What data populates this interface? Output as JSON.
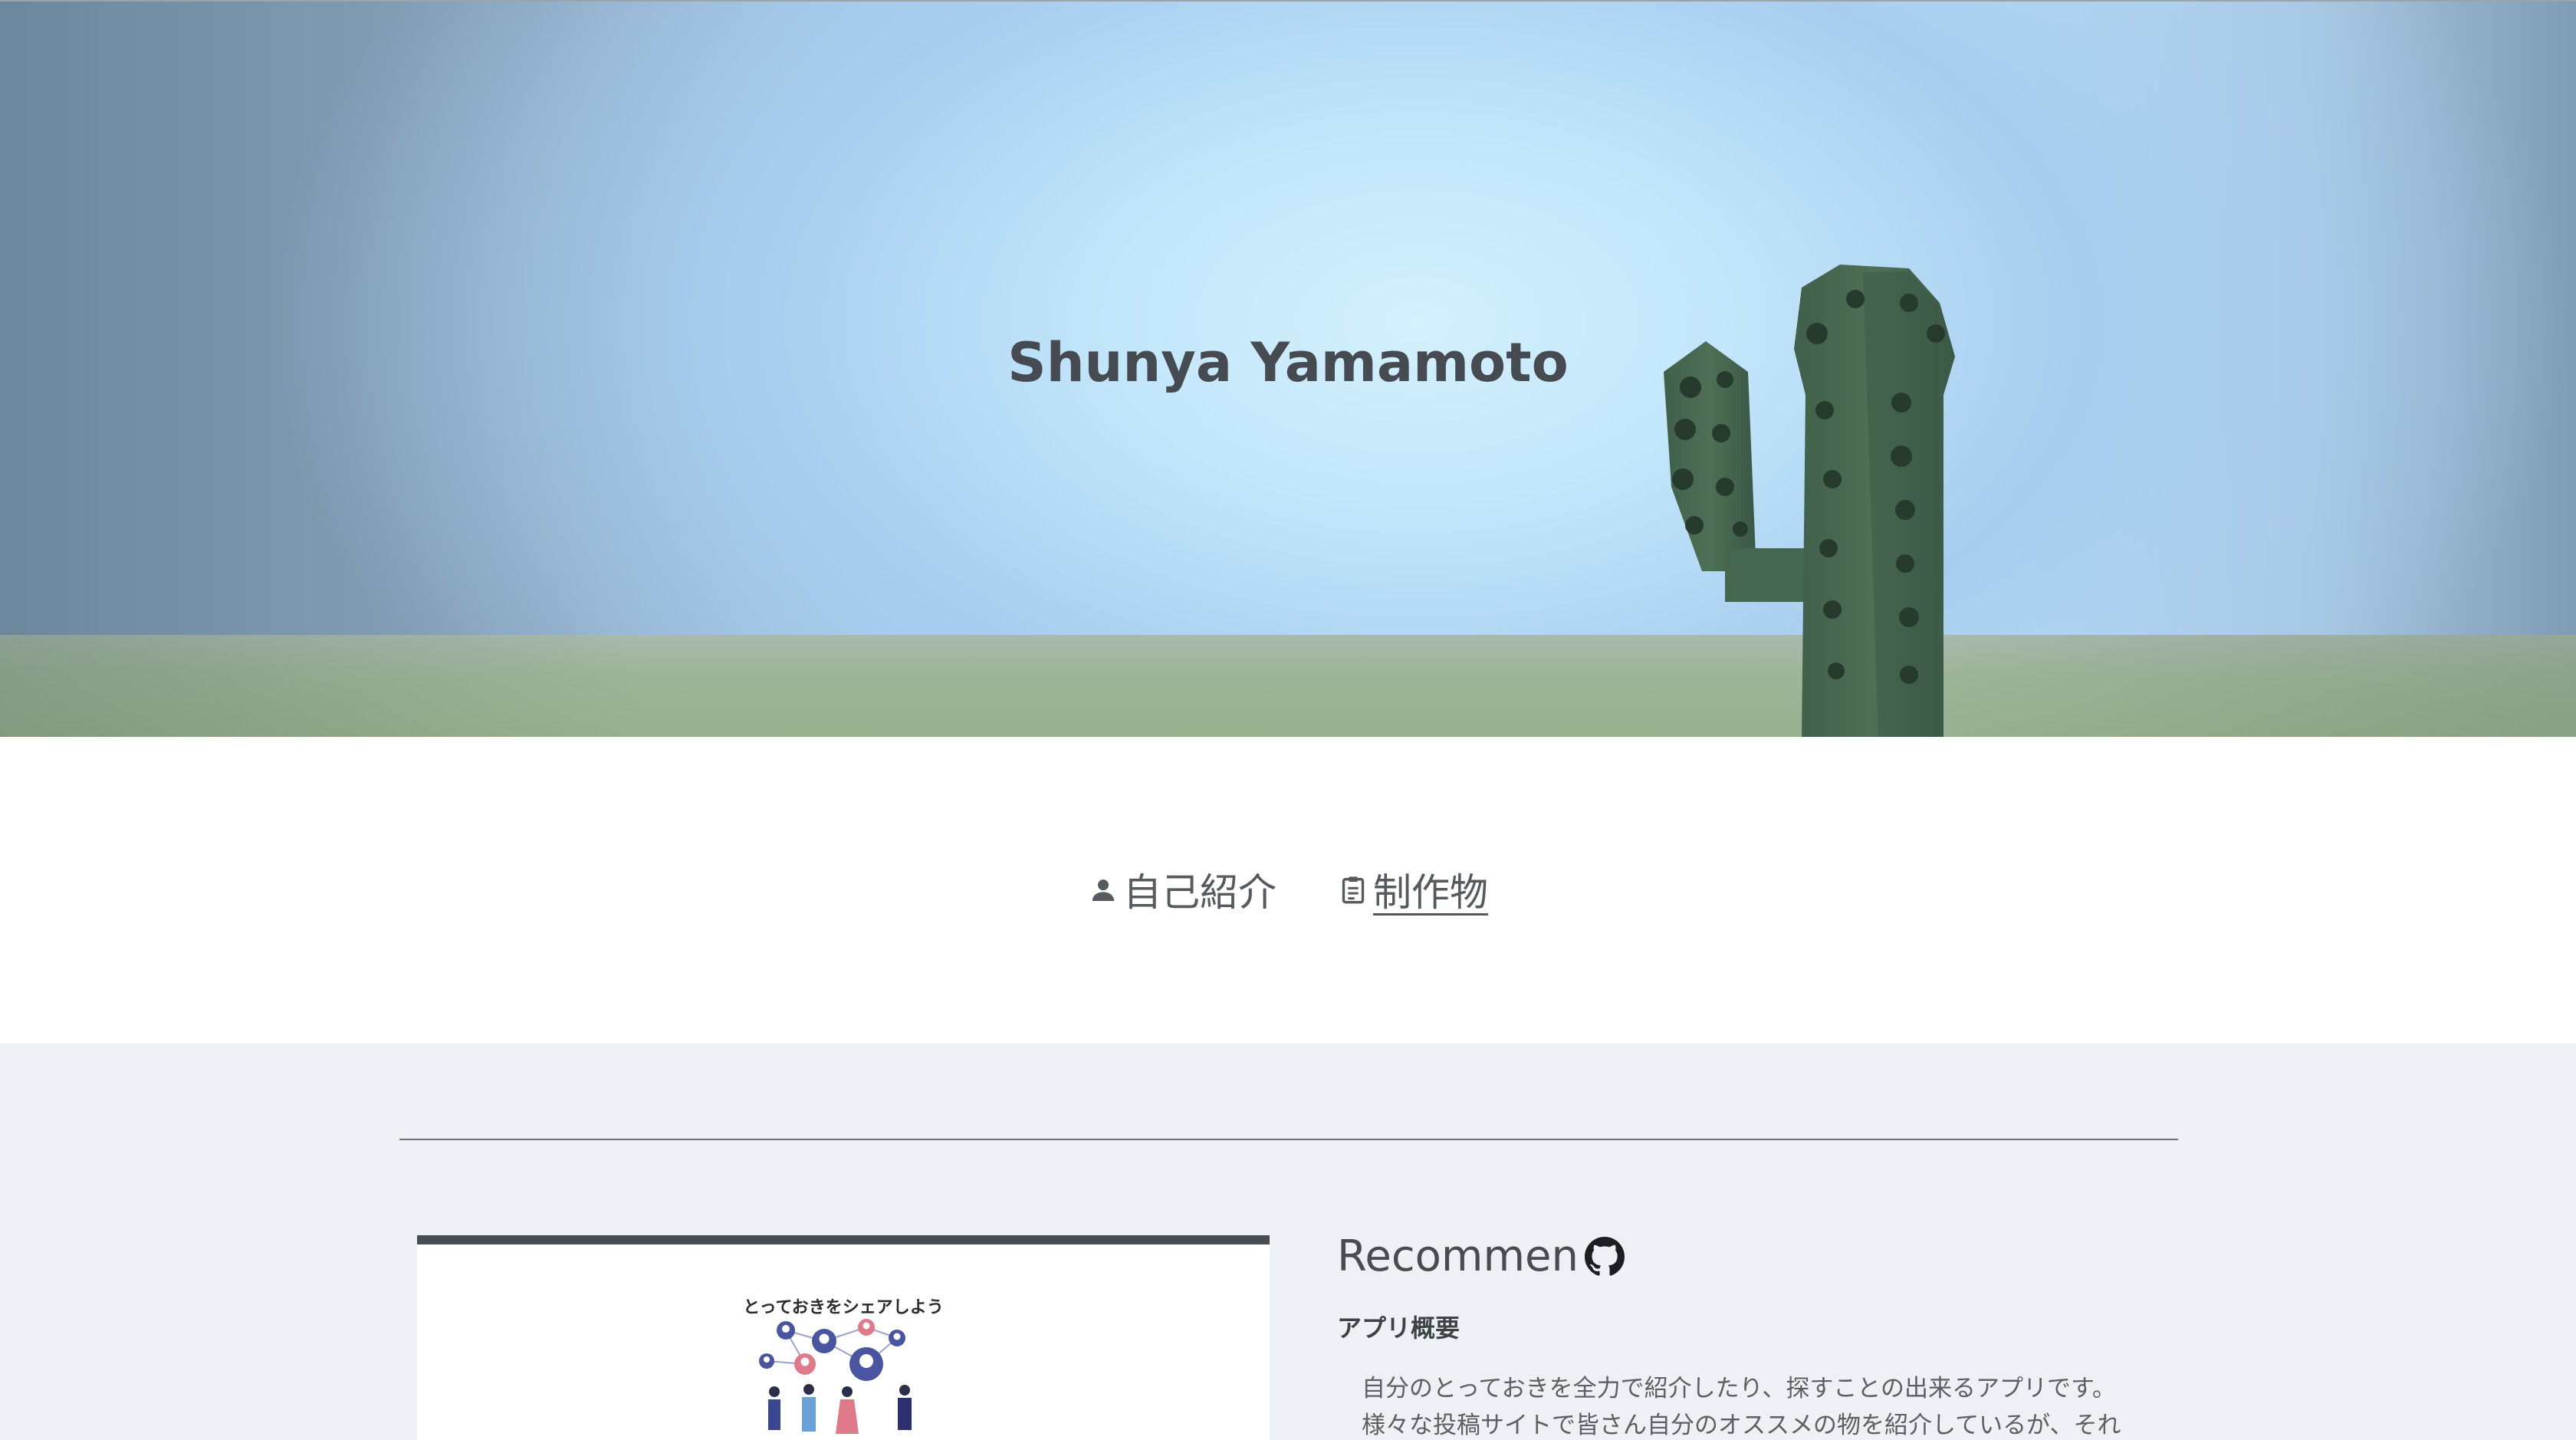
{
  "hero": {
    "title": "Shunya Yamamoto"
  },
  "nav": {
    "items": [
      {
        "label": "自己紹介",
        "icon": "person-icon",
        "active": false
      },
      {
        "label": "制作物",
        "icon": "clipboard-icon",
        "active": true
      }
    ]
  },
  "works": {
    "items": [
      {
        "thumbnail_caption": "とっておきをシェアしよう",
        "title": "Recommen",
        "link_icon": "github-icon",
        "section_heading": "アプリ概要",
        "description_lines": [
          "自分のとっておきを全力で紹介したり、探すことの出来るアプリです。",
          "様々な投稿サイトで皆さん自分のオススメの物を紹介しているが、それ"
        ]
      }
    ]
  },
  "colors": {
    "title_text": "#454b50",
    "nav_text": "#555a5e",
    "works_background": "#edf1f5",
    "divider": "#6d7278",
    "thumb_top_border": "#474c51"
  }
}
